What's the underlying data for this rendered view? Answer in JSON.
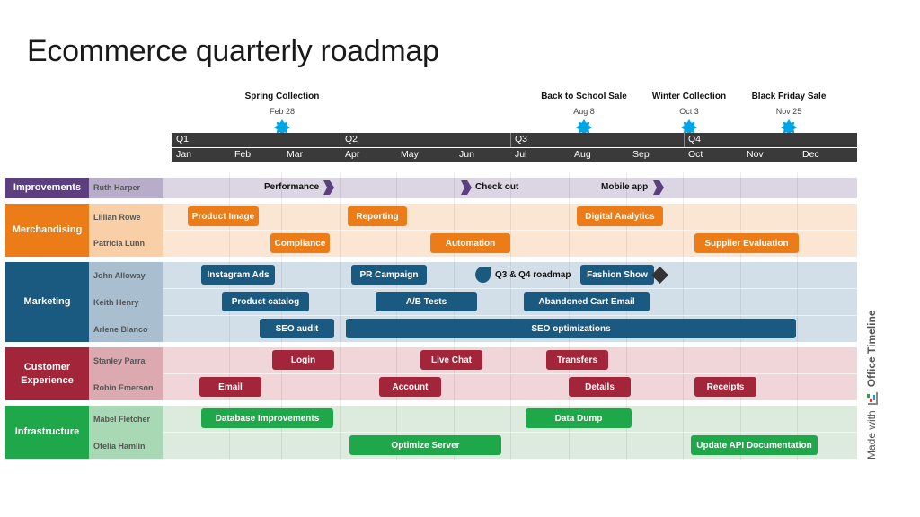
{
  "title": "Ecommerce quarterly roadmap",
  "milestones": [
    {
      "label": "Spring Collection",
      "date": "Feb 28"
    },
    {
      "label": "Back to School Sale",
      "date": "Aug 8"
    },
    {
      "label": "Winter Collection",
      "date": "Oct 3"
    },
    {
      "label": "Black Friday Sale",
      "date": "Nov 25"
    }
  ],
  "milestone_color": "#00a6e3",
  "quarters": [
    "Q1",
    "Q2",
    "Q3",
    "Q4"
  ],
  "months": [
    "Jan",
    "Feb",
    "Mar",
    "Apr",
    "May",
    "Jun",
    "Jul",
    "Aug",
    "Sep",
    "Oct",
    "Nov",
    "Dec"
  ],
  "groups": {
    "improvements": {
      "label": "Improvements",
      "color": "#5b3f7e",
      "owners": [
        "Ruth Harper"
      ],
      "milestones": [
        "Performance",
        "Check out",
        "Mobile app"
      ]
    },
    "merchandising": {
      "label": "Merchandising",
      "color": "#ec7c17",
      "owners": [
        "Lillian Rowe",
        "Patricia Lunn"
      ],
      "tasks": [
        "Product Image",
        "Reporting",
        "Digital Analytics",
        "Compliance",
        "Automation",
        "Supplier Evaluation"
      ]
    },
    "marketing": {
      "label": "Marketing",
      "color": "#1b5a80",
      "owners": [
        "John Alloway",
        "Keith Henry",
        "Arlene Blanco"
      ],
      "tasks": [
        "Instagram Ads",
        "PR Campaign",
        "Fashion Show",
        "Product catalog",
        "A/B Tests",
        "Abandoned Cart Email",
        "SEO audit",
        "SEO optimizations"
      ],
      "milestone_label": "Q3 & Q4 roadmap"
    },
    "customer_experience": {
      "label": "Customer Experience",
      "color": "#a3253a",
      "owners": [
        "Stanley Parra",
        "Robin Emerson"
      ],
      "tasks": [
        "Login",
        "Live Chat",
        "Transfers",
        "Email",
        "Account",
        "Details",
        "Receipts"
      ]
    },
    "infrastructure": {
      "label": "Infrastructure",
      "color": "#1fa84a",
      "owners": [
        "Mabel Fletcher",
        "Ofelia Hamlin"
      ],
      "tasks": [
        "Database Improvements",
        "Data Dump",
        "Optimize Server",
        "Update API Documentation"
      ]
    }
  },
  "credit": {
    "prefix": "Made with",
    "brand": "Office Timeline"
  }
}
